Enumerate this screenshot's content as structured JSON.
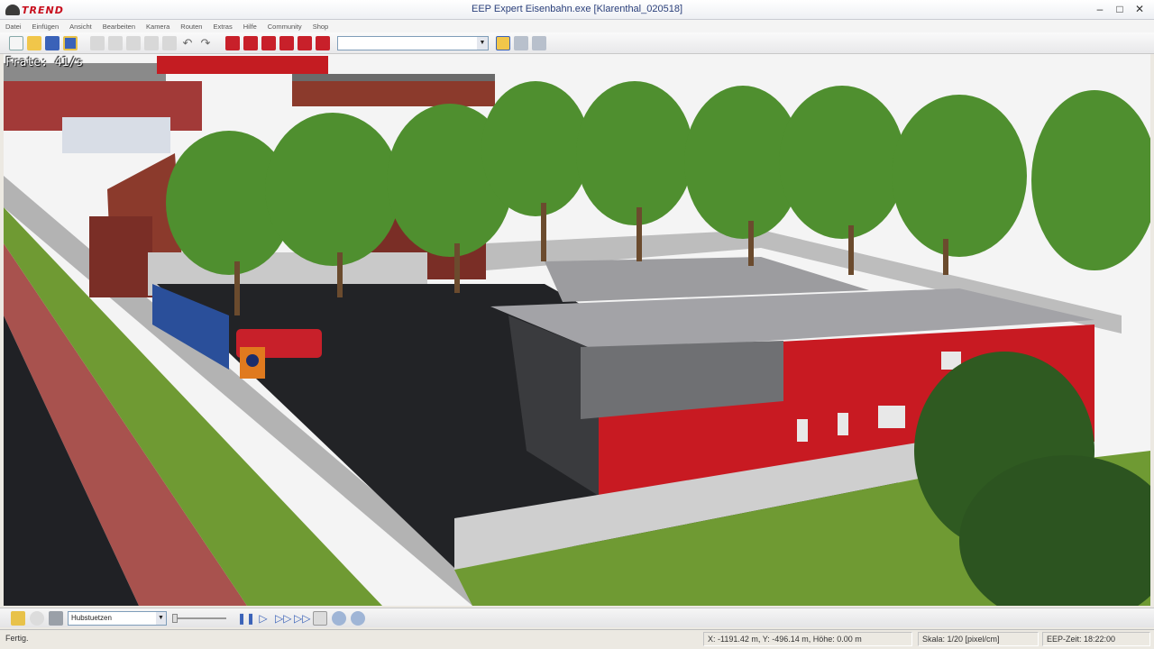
{
  "window": {
    "title": "EEP Expert  Eisenbahn.exe  [Klarenthal_020518]",
    "logo_text": "TREND"
  },
  "menu": [
    "Datei",
    "Einfügen",
    "Ansicht",
    "Bearbeiten",
    "Kamera",
    "Routen",
    "Extras",
    "Hilfe",
    "Community",
    "Shop"
  ],
  "viewport": {
    "frame_rate": "Frate: 41/s"
  },
  "bottom_toolbar": {
    "selected_object": "Hubstuetzen"
  },
  "status": {
    "message": "Fertig.",
    "coordinates": "X: -1191.42 m, Y: -496.14 m, Höhe: 0.00 m",
    "scale": "Skala: 1/20 [pixel/cm]",
    "eep_time": "EEP-Zeit: 18:22:00"
  },
  "colors": {
    "building_red": "#c81a22",
    "grass": "#6f9a33",
    "asphalt": "#222326",
    "tree": "#4f8f2f"
  },
  "icons": {
    "toolbar": [
      "new-file-icon",
      "open-folder-icon",
      "save-icon",
      "save-as-icon",
      "copy-icon",
      "paste-icon",
      "cut-icon",
      "delete-icon",
      "select-icon",
      "undo-icon",
      "redo-icon",
      "track-icon",
      "road-icon",
      "tram-icon",
      "water-icon",
      "control-icon",
      "signal-icon"
    ],
    "bottom": [
      "edit-icon",
      "bulb-icon",
      "camera-icon",
      "pause-icon",
      "play-icon",
      "forward-icon",
      "fast-forward-icon",
      "screen-icon",
      "zoom-in-icon",
      "zoom-out-icon"
    ]
  }
}
